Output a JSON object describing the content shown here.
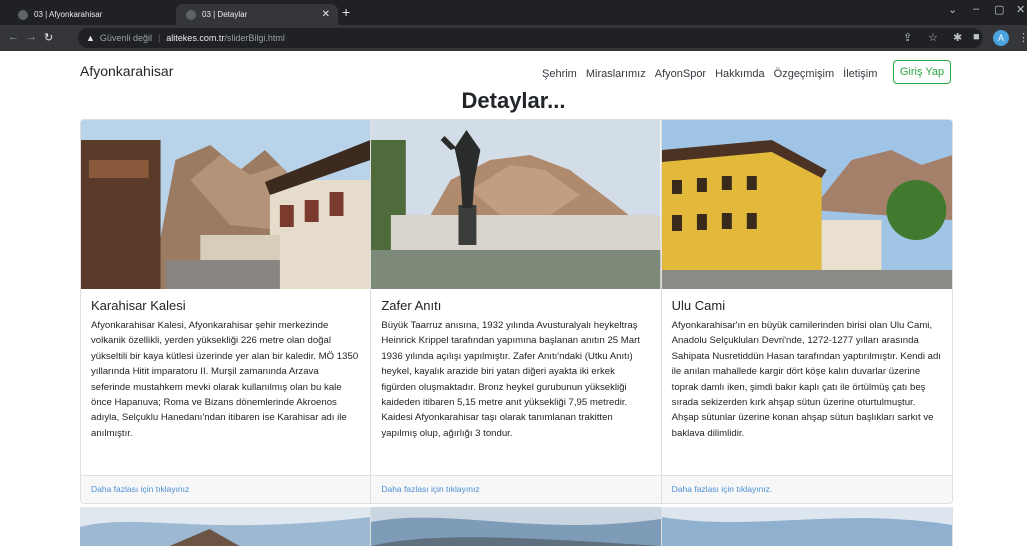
{
  "browser": {
    "tabs": [
      {
        "title": "03 | Afyonkarahisar",
        "active": false
      },
      {
        "title": "03 | Detaylar",
        "active": true
      }
    ],
    "address": {
      "security_label": "Güvenli değil",
      "domain": "alitekes.com.tr",
      "path": "/sliderBilgi.html"
    },
    "profile_initial": "A"
  },
  "site": {
    "brand": "Afyonkarahisar",
    "nav": [
      "Şehrim",
      "Miraslarımız",
      "AfyonSpor",
      "Hakkımda",
      "Özgeçmişim",
      "İletişim"
    ],
    "login_label": "Giriş Yap",
    "page_title": "Detaylar...",
    "accent_color": "#28a745",
    "link_color": "#4d8fd6"
  },
  "cards": [
    {
      "title": "Karahisar Kalesi",
      "text": "Afyonkarahisar Kalesi, Afyonkarahisar şehir merkezinde volkanik özellikli, yerden yüksekliği 226 metre olan doğal yükseltili bir kaya kütlesi üzerinde yer alan bir kaledir. MÖ 1350 yıllarında Hitit imparatoru II. Murşil zamanında Arzava seferinde mustahkem mevki olarak kullanılmış olan bu kale önce Hapanuva; Roma ve Bizans dönemlerinde Akroenos adıyla, Selçuklu Hanedanı'ndan itibaren ise Karahisar adı ile anılmıştır.",
      "link": "Daha fazlası için tıklayınız"
    },
    {
      "title": "Zafer Anıtı",
      "text": "Büyük Taarruz anısına, 1932 yılında Avusturalyalı heykeltraş Heinrick Krippel tarafından yapımına başlanan anıtın 25 Mart 1936 yılında açılışı yapılmıştır. Zafer Anıtı'ndaki (Utku Anıtı) heykel, kayalık arazide biri yatan diğeri ayakta iki erkek figürden oluşmaktadır. Bronz heykel gurubunun yüksekliği kaideden itibaren 5,15 metre anıt yüksekliği 7,95 metredir. Kaidesi Afyonkarahisar taşı olarak tanımlanan trakitten yapılmış olup, ağırlığı 3 tondur.",
      "link": "Daha fazlası için tıklayınız"
    },
    {
      "title": "Ulu Cami",
      "text": "Afyonkarahisar'ın en büyük camilerinden birisi olan Ulu Cami, Anadolu Selçukluları Devri'nde, 1272-1277 yılları arasında Sahipata Nusretiddün Hasan tarafından yaptırılmıştır. Kendi adı ile anılan mahallede kargir dört köşe kalın duvarlar üzerine toprak damlı iken, şimdi bakır kaplı çatı ile örtülmüş çatı beş sırada sekizerden kırk ahşap sütun üzerine oturtulmuştur. Ahşap sütunlar üzerine konan ahşap sütun başlıkları sarkıt ve baklava dilimlidir.",
      "link": "Daha fazlası için tıklayınız."
    }
  ]
}
